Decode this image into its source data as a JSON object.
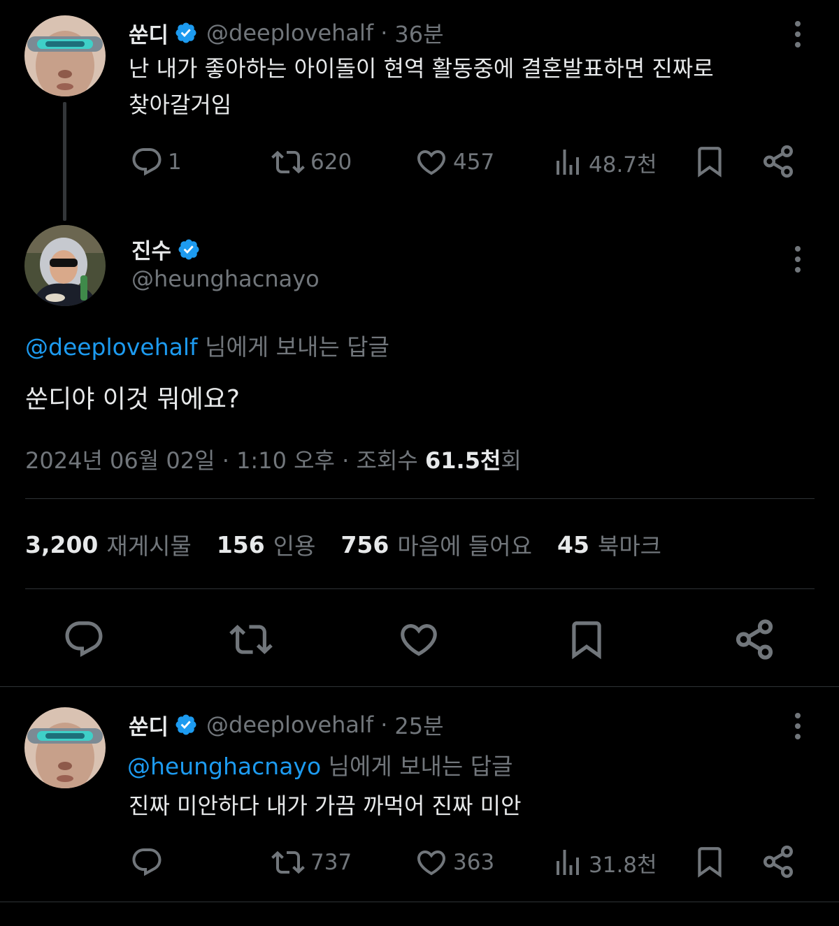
{
  "colors": {
    "background": "#000000",
    "text": "#e7e9ea",
    "muted": "#71767b",
    "accent": "#1d9bf0",
    "divider": "#2f3336"
  },
  "tweet1": {
    "name": "쑨디",
    "handle": "@deeplovehalf",
    "separator": "·",
    "time": "36분",
    "text_line1": "난 내가 좋아하는 아이돌이 현역 활동중에 결혼발표하면 진짜로",
    "text_line2": "찾아갈거임",
    "replies": "1",
    "retweets": "620",
    "likes": "457",
    "views": "48.7천",
    "icons": [
      "reply-icon",
      "retweet-icon",
      "like-icon",
      "views-icon",
      "bookmark-icon",
      "share-icon",
      "more-icon"
    ]
  },
  "main_tweet": {
    "name": "진수",
    "handle": "@heunghacnayo",
    "reply_to_mention": "@deeplovehalf",
    "reply_to_suffix": " 님에게 보내는 답글",
    "text": "쑨디야 이것 뭐에요?",
    "date": "2024년 06월 02일",
    "separator": "·",
    "time": "1:10 오후",
    "views_label": "조회수 ",
    "views_count": "61.5천",
    "views_suffix": "회",
    "stats": {
      "retweets_count": "3,200",
      "retweets_label": "재게시물",
      "quotes_count": "156",
      "quotes_label": "인용",
      "likes_count": "756",
      "likes_label": "마음에 들어요",
      "bookmarks_count": "45",
      "bookmarks_label": "북마크"
    }
  },
  "reply_tweet": {
    "name": "쑨디",
    "handle": "@deeplovehalf",
    "separator": "·",
    "time": "25분",
    "reply_to_mention": "@heunghacnayo",
    "reply_to_suffix": " 님에게 보내는 답글",
    "text": "진짜 미안하다 내가 가끔 까먹어 진짜 미안",
    "replies": "",
    "retweets": "737",
    "likes": "363",
    "views": "31.8천"
  }
}
